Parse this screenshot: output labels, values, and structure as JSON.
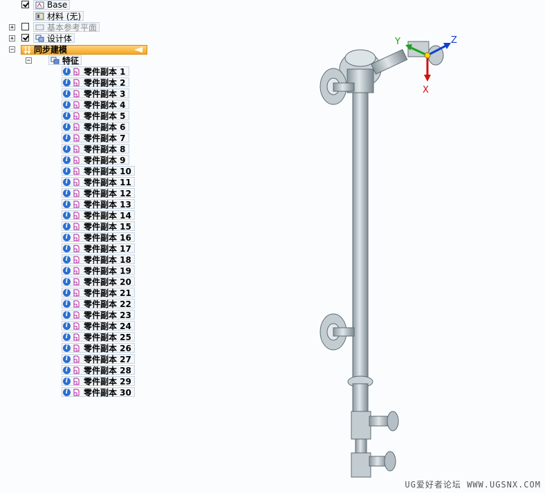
{
  "tree": {
    "base": {
      "label": "Base",
      "checked": true
    },
    "material": {
      "label": "材料 (无)"
    },
    "ref_planes": {
      "label": "基本参考平面",
      "checked": false,
      "expander": "+"
    },
    "design_body": {
      "label": "设计体",
      "checked": true,
      "expander": "+"
    },
    "sync_modeling": {
      "label": "同步建模",
      "expander": "−"
    },
    "features_node": {
      "label": "特征",
      "expander": "−"
    },
    "features": [
      "零件副本 1",
      "零件副本 2",
      "零件副本 3",
      "零件副本 4",
      "零件副本 5",
      "零件副本 6",
      "零件副本 7",
      "零件副本 8",
      "零件副本 9",
      "零件副本 10",
      "零件副本 11",
      "零件副本 12",
      "零件副本 13",
      "零件副本 14",
      "零件副本 15",
      "零件副本 16",
      "零件副本 17",
      "零件副本 18",
      "零件副本 19",
      "零件副本 20",
      "零件副本 21",
      "零件副本 22",
      "零件副本 23",
      "零件副本 24",
      "零件副本 25",
      "零件副本 26",
      "零件副本 27",
      "零件副本 28",
      "零件副本 29",
      "零件副本 30"
    ]
  },
  "triad": {
    "x_label": "X",
    "y_label": "Y",
    "z_label": "Z",
    "x_color": "#d01010",
    "y_color": "#1aa31a",
    "z_color": "#1040d0"
  },
  "watermark": "UG爱好者论坛 WWW.UGSNX.COM",
  "colors": {
    "sync_highlight": "#f5a623",
    "part_fill": "#b9c4ca",
    "part_stroke": "#5d6b73"
  }
}
